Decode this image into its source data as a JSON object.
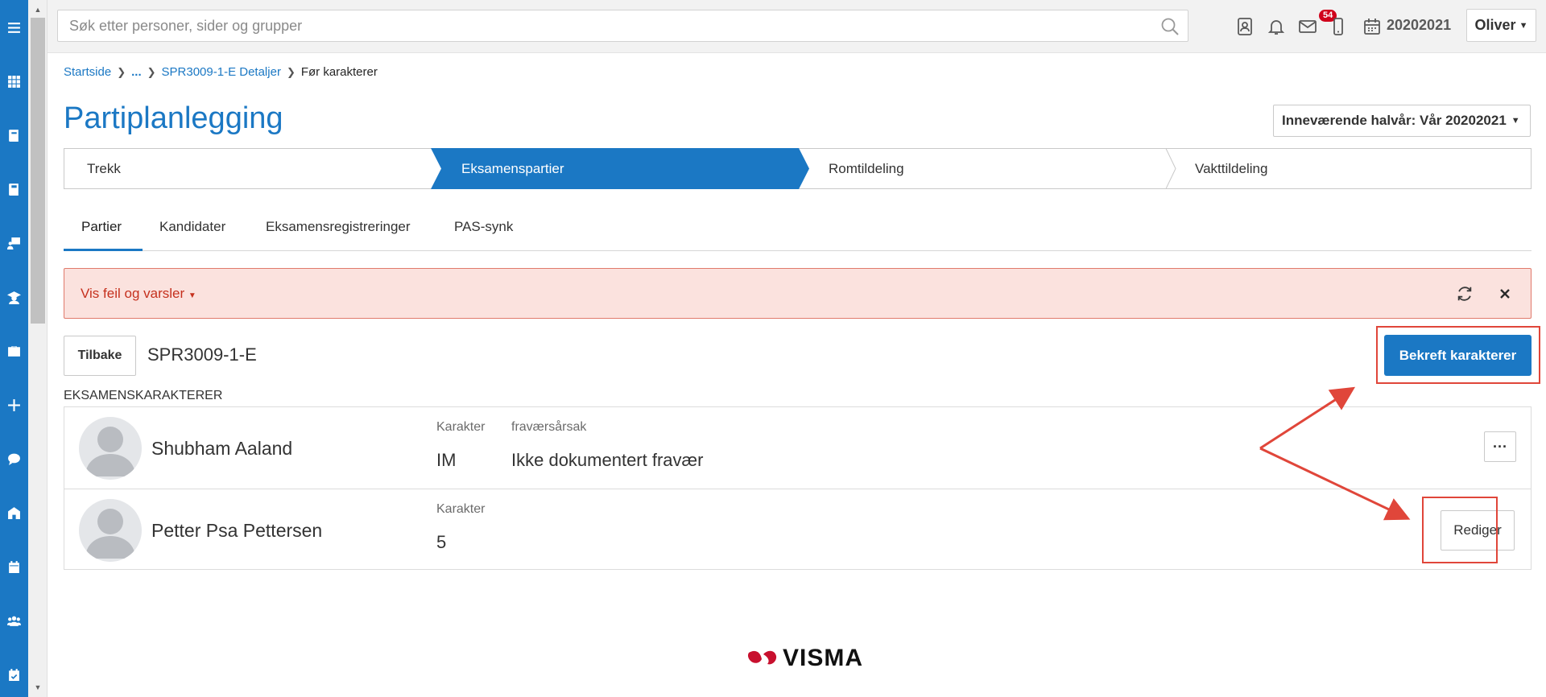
{
  "search": {
    "placeholder": "Søk etter personer, sider og grupper"
  },
  "topbar": {
    "notification_count": "54",
    "term": "20202021",
    "user": "Oliver"
  },
  "breadcrumb": {
    "items": [
      "Startside",
      "...",
      "SPR3009-1-E Detaljer"
    ],
    "current": "Før karakterer"
  },
  "page": {
    "title": "Partiplanlegging",
    "semester_select": "Inneværende halvår: Vår 20202021"
  },
  "wizard": {
    "steps": [
      "Trekk",
      "Eksamenspartier",
      "Romtildeling",
      "Vakttildeling"
    ],
    "active_index": 1
  },
  "tabs": {
    "items": [
      "Partier",
      "Kandidater",
      "Eksamensregistreringer",
      "PAS-synk"
    ],
    "active_index": 0
  },
  "alert": {
    "toggle_label": "Vis feil og varsler"
  },
  "toolbar": {
    "back_label": "Tilbake",
    "code": "SPR3009-1-E",
    "confirm_label": "Bekreft karakterer"
  },
  "section": {
    "heading": "EKSAMENSKARAKTERER"
  },
  "grades": [
    {
      "name": "Shubham Aaland",
      "grade_label": "Karakter",
      "grade": "IM",
      "reason_label": "fraværsårsak",
      "reason": "Ikke dokumentert fravær",
      "action": "···"
    },
    {
      "name": "Petter Psa Pettersen",
      "grade_label": "Karakter",
      "grade": "5",
      "action": "Rediger"
    }
  ],
  "footer": {
    "logo_text": "VISMA"
  },
  "colors": {
    "brand": "#1b78c4",
    "alert_bg": "#fbe2de",
    "alert_text": "#c5301d",
    "annotation": "#e0463a"
  },
  "icons": {
    "rail": [
      "menu-icon",
      "apps-grid-icon",
      "book-icon",
      "notebook-icon",
      "teacher-board-icon",
      "graduate-icon",
      "briefcase-icon",
      "plus-icon",
      "chat-icon",
      "school-icon",
      "calendar-icon",
      "group-icon",
      "calendar-check-icon"
    ],
    "topbar": [
      "search-icon",
      "contact-card-icon",
      "bell-icon",
      "mail-icon",
      "mobile-icon",
      "calendar-icon"
    ]
  }
}
